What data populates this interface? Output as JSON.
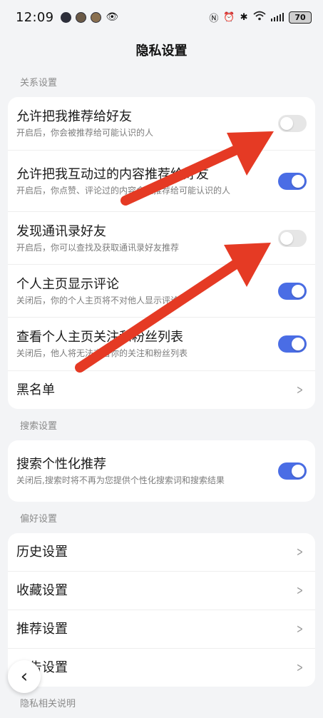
{
  "status_bar": {
    "time": "12:09",
    "battery": "70"
  },
  "page_title": "隐私设置",
  "sections": {
    "relation": "关系设置",
    "search": "搜索设置",
    "preference": "偏好设置",
    "privacy_note": "隐私相关说明"
  },
  "relation_rows": [
    {
      "title": "允许把我推荐给好友",
      "sub": "开启后，你会被推荐给可能认识的人",
      "toggle": "off"
    },
    {
      "title": "允许把我互动过的内容推荐给好友",
      "sub": "开启后，你点赞、评论过的内容会被推荐给可能认识的人",
      "toggle": "on"
    },
    {
      "title": "发现通讯录好友",
      "sub": "开启后，你可以查找及获取通讯录好友推荐",
      "toggle": "off"
    },
    {
      "title": "个人主页显示评论",
      "sub": "关闭后，你的个人主页将不对他人显示评论",
      "toggle": "on"
    },
    {
      "title": "查看个人主页关注和粉丝列表",
      "sub": "关闭后，他人将无法查看你的关注和粉丝列表",
      "toggle": "on"
    },
    {
      "title": "黑名单"
    }
  ],
  "search_rows": [
    {
      "title": "搜索个性化推荐",
      "sub": "关闭后,搜索时将不再为您提供个性化搜索词和搜索结果",
      "toggle": "on"
    }
  ],
  "preference_rows": [
    {
      "title": "历史设置"
    },
    {
      "title": "收藏设置"
    },
    {
      "title": "推荐设置"
    },
    {
      "title": "广告设置"
    }
  ],
  "colors": {
    "toggle_on": "#4a6de5",
    "annotation_arrow": "#e53a24"
  }
}
